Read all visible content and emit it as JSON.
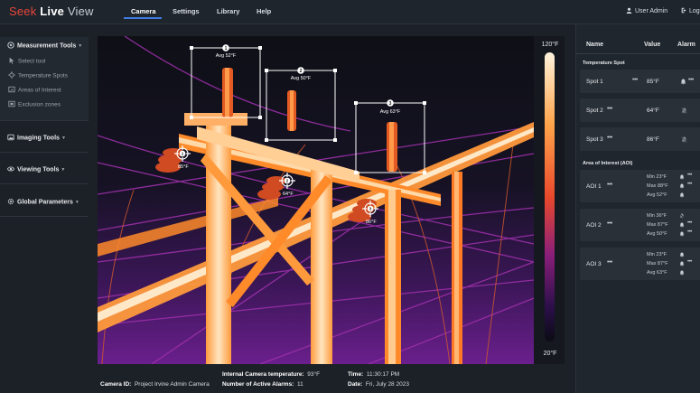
{
  "brand": {
    "part1": "Seek",
    "part2": "Live",
    "part3": "View"
  },
  "nav": {
    "tabs": [
      "Camera",
      "Settings",
      "Library",
      "Help"
    ],
    "active_tab": "Camera"
  },
  "user": {
    "name": "User Admin",
    "logout": "Log"
  },
  "sidebar": {
    "measurement_tools": {
      "label": "Measurement Tools",
      "items": [
        "Select tool",
        "Temperature Spots",
        "Areas of Interest",
        "Exclusion zones"
      ]
    },
    "imaging_tools": "Imaging Tools",
    "viewing_tools": "Viewing Tools",
    "global_parameters": "Global Parameters"
  },
  "viewer": {
    "aoi_boxes": [
      {
        "number": "1",
        "label": "Avg 52°F"
      },
      {
        "number": "2",
        "label": "Avg 50°F"
      },
      {
        "number": "3",
        "label": "Avg 63°F"
      }
    ],
    "spots": [
      {
        "number": "1",
        "label": "85°F"
      },
      {
        "number": "2",
        "label": "64°F"
      },
      {
        "number": "3",
        "label": "86°F"
      }
    ],
    "scale": {
      "max": "120°F",
      "min": "20°F"
    }
  },
  "info": {
    "camera_id_label": "Camera ID:",
    "camera_id_value": "Project Irvine Admin Camera",
    "internal_temp_label": "Internal Camera temperature:",
    "internal_temp_value": "93°F",
    "alarms_label": "Number of Active Alarms:",
    "alarms_value": "11",
    "time_label": "Time:",
    "time_value": "11:30:17 PM",
    "date_label": "Date:",
    "date_value": "Fri, July 28 2023"
  },
  "panel": {
    "columns": [
      "Name",
      "Value",
      "Alarm"
    ],
    "temperature_spot_title": "Temperature Spot",
    "spots": [
      {
        "name": "Spot 1",
        "value": "85°F",
        "alarm": "on"
      },
      {
        "name": "Spot 2",
        "value": "64°F",
        "alarm": "off"
      },
      {
        "name": "Spot 3",
        "value": "86°F",
        "alarm": "off"
      }
    ],
    "aoi_title": "Area of Interest (AOI)",
    "aois": [
      {
        "name": "AOI 1",
        "min": "Min 23°F",
        "max": "Max 88°F",
        "avg": "Avg 52°F",
        "alarms": [
          "on",
          "on",
          "on"
        ]
      },
      {
        "name": "AOI 2",
        "min": "Min 36°F",
        "max": "Max 87°F",
        "avg": "Avg 50°F",
        "alarms": [
          "off",
          "on",
          "on"
        ]
      },
      {
        "name": "AOI 3",
        "min": "Min 23°F",
        "max": "Max 87°F",
        "avg": "Avg 63°F",
        "alarms": [
          "on",
          "on",
          "on"
        ]
      }
    ]
  },
  "colors": {
    "accent": "#3f7be0",
    "brand_red": "#e8453c",
    "hot": "#ffe9c8",
    "warm": "#ff8a2a",
    "cool": "#6b1fa3",
    "cold": "#1a0d3a"
  }
}
